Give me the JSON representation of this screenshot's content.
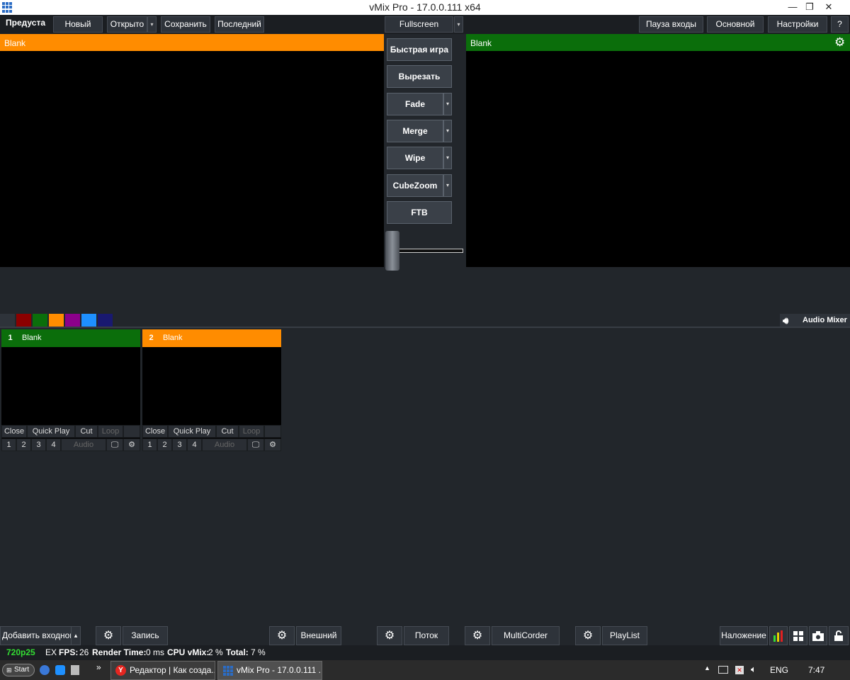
{
  "window": {
    "title": "vMix Pro - 17.0.0.111 x64",
    "minimize_glyph": "—",
    "maximize_glyph": "❐",
    "close_glyph": "✕"
  },
  "topbar": {
    "preset_tab": "Предуста",
    "new": "Новый",
    "open": "Открыто",
    "save": "Сохранить",
    "recent": "Последний",
    "fullscreen": "Fullscreen",
    "pause_inputs": "Пауза входы",
    "main": "Основной",
    "settings": "Настройки",
    "help": "?",
    "dropdown_glyph": "▾"
  },
  "preview": {
    "title": "Blank"
  },
  "output": {
    "title": "Blank"
  },
  "transitions": {
    "quick_play": "Быстрая игра",
    "cut": "Вырезать",
    "fade": "Fade",
    "merge": "Merge",
    "wipe": "Wipe",
    "cubezoom": "CubeZoom",
    "ftb": "FTB",
    "tbar_level": 0.18
  },
  "color_filters": [
    "#2e333a",
    "#8b0000",
    "#0b6e0b",
    "#ff8c00",
    "#8b008b",
    "#1e90ff",
    "#191970"
  ],
  "audio_mixer": {
    "label": "Audio Mixer",
    "icon": "speaker-icon"
  },
  "inputs": [
    {
      "number": "1",
      "title": "Blank",
      "color": "#0b6e0b",
      "buttons": {
        "close": "Close",
        "quick_play": "Quick Play",
        "cut": "Cut",
        "loop": "Loop"
      },
      "overlays": [
        "1",
        "2",
        "3",
        "4"
      ],
      "audio": "Audio"
    },
    {
      "number": "2",
      "title": "Blank",
      "color": "#ff8c00",
      "buttons": {
        "close": "Close",
        "quick_play": "Quick Play",
        "cut": "Cut",
        "loop": "Loop"
      },
      "overlays": [
        "1",
        "2",
        "3",
        "4"
      ],
      "audio": "Audio"
    }
  ],
  "bottombar": {
    "add_input": "Добавить входного",
    "record": "Запись",
    "external": "Внешний",
    "stream": "Поток",
    "multicorder": "MultiCorder",
    "playlist": "PlayList",
    "overlay": "Наложение",
    "up_glyph": "▴"
  },
  "status": {
    "format": "720p25",
    "ex": "EX",
    "fps_label": "FPS:",
    "fps": "26",
    "render_label": "Render Time:",
    "render": "0 ms",
    "cpu_label": "CPU vMix:",
    "cpu": "2 %",
    "total_label": "Total:",
    "total": "7 %",
    "format_color": "#33dd33"
  },
  "taskbar": {
    "start": "Start",
    "chevron": "»",
    "task1": "Редактор | Как созда...",
    "task2": "vMix Pro - 17.0.0.111 ...",
    "lang": "ENG",
    "time": "7:47"
  }
}
